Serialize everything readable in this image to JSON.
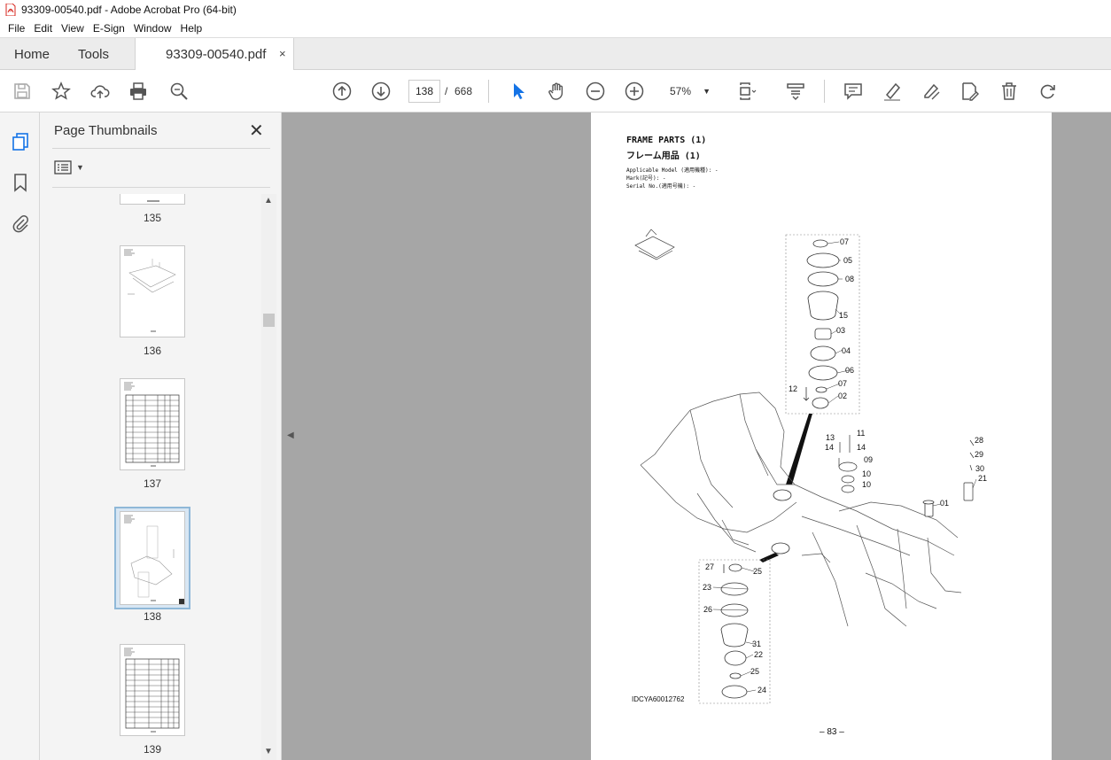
{
  "window": {
    "title": "93309-00540.pdf - Adobe Acrobat Pro (64-bit)"
  },
  "menu": [
    "File",
    "Edit",
    "View",
    "E-Sign",
    "Window",
    "Help"
  ],
  "tabs": {
    "home": "Home",
    "tools": "Tools",
    "document": "93309-00540.pdf",
    "close": "×"
  },
  "toolbar": {
    "current_page": "138",
    "page_separator": "/",
    "total_pages": "668",
    "zoom": "57%"
  },
  "thumbnails": {
    "header": "Page Thumbnails",
    "close": "✕",
    "pages": [
      "135",
      "136",
      "137",
      "138",
      "139"
    ],
    "selected": "138"
  },
  "document_page": {
    "title_en": "FRAME PARTS (1)",
    "title_jp": "フレーム用品 (1)",
    "applicable_model": "Applicable Model (適用機種): -",
    "mark": "Mark(記号): -",
    "serial_no": "Serial No.(適用号機): -",
    "callouts": [
      "07",
      "05",
      "08",
      "15",
      "03",
      "04",
      "06",
      "07",
      "02",
      "12",
      "13",
      "11",
      "14",
      "14",
      "09",
      "10",
      "10",
      "28",
      "29",
      "30",
      "21",
      "01",
      "27",
      "25",
      "23",
      "26",
      "31",
      "22",
      "25",
      "24"
    ],
    "figure_ref": "IDCYA60012762",
    "page_number": "– 83 –"
  },
  "colors": {
    "accent_blue": "#1473e6",
    "selection": "#d8e6f3",
    "doc_background": "#a6a6a6",
    "acrobat_red": "#d7261e"
  }
}
